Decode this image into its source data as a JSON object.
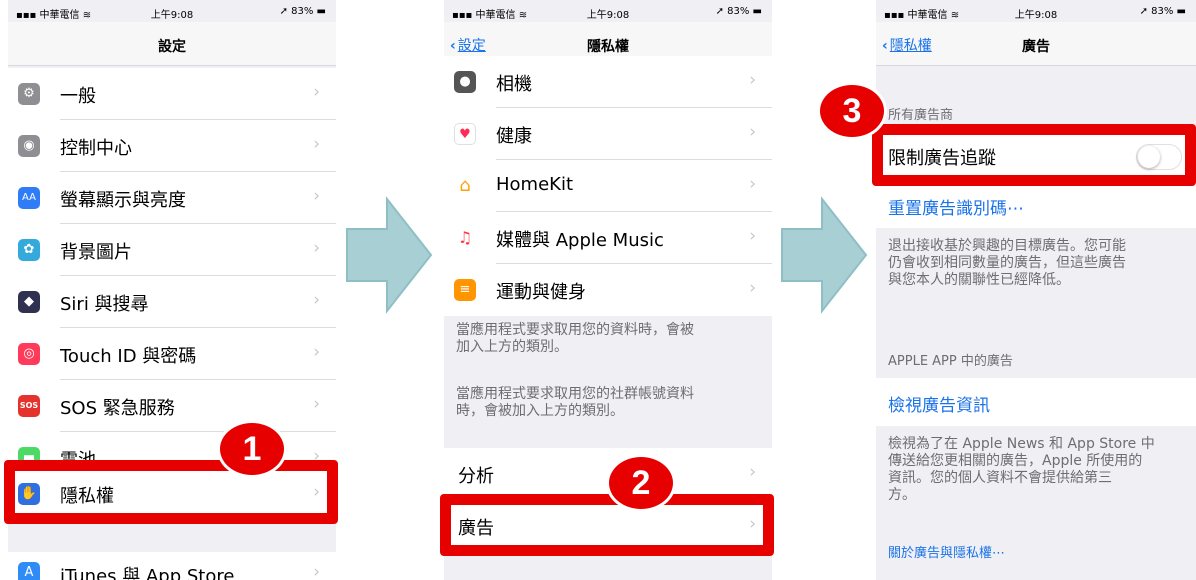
{
  "status": {
    "carrier": "▪▪▪ 中華電信 ≋",
    "time": "上午9:08",
    "battery": "➚ 83% ▬"
  },
  "phone1": {
    "title": "設定",
    "items": [
      {
        "label": "一般",
        "icon": "⚙",
        "icon_color": "#8e8e93"
      },
      {
        "label": "控制中心",
        "icon": "◉",
        "icon_color": "#8e8e93"
      },
      {
        "label": "螢幕顯示與亮度",
        "icon": "AA",
        "icon_color": "#2f7cf6"
      },
      {
        "label": "背景圖片",
        "icon": "✿",
        "icon_color": "#34aadc"
      },
      {
        "label": "Siri 與搜尋",
        "icon": "◆",
        "icon_color": "#303050"
      },
      {
        "label": "Touch ID 與密碼",
        "icon": "◎",
        "icon_color": "#ff3b5c"
      },
      {
        "label": "SOS 緊急服務",
        "icon": "SOS",
        "icon_color": "#e5322d"
      },
      {
        "label": "電池",
        "icon": "▬",
        "icon_color": "#4cd964"
      },
      {
        "label": "隱私權",
        "icon": "✋",
        "icon_color": "#2f6fe0"
      },
      {
        "label": "iTunes 與 App Store",
        "icon": "A",
        "icon_color": "#2f8cf6"
      }
    ]
  },
  "phone2": {
    "back": "設定",
    "title": "隱私權",
    "items": [
      {
        "label": "相機",
        "icon": "●",
        "icon_color": "#555555"
      },
      {
        "label": "健康",
        "icon": "♥",
        "icon_color": "#ffffff"
      },
      {
        "label": "HomeKit",
        "icon": "⌂",
        "icon_color": "#ff9f0a"
      },
      {
        "label": "媒體與 Apple Music",
        "icon": "♫",
        "icon_color": "#ffffff"
      },
      {
        "label": "運動與健身",
        "icon": "≡",
        "icon_color": "#ff9500"
      }
    ],
    "note1_line1": "當應用程式要求取用您的資料時，會被",
    "note1_line2": "加入上方的類別。",
    "note2_line1": "當應用程式要求取用您的社群帳號資料",
    "note2_line2": "時，會被加入上方的類別。",
    "analytics": "分析",
    "ads": "廣告"
  },
  "phone3": {
    "back": "隱私權",
    "title": "廣告",
    "section1": "所有廣告商",
    "limit_tracking": "限制廣告追蹤",
    "toggle_state": "off",
    "reset_link": "重置廣告識別碼⋯",
    "note1_line1": "退出接收基於興趣的目標廣告。您可能",
    "note1_line2": "仍會收到相同數量的廣告，但這些廣告",
    "note1_line3": "與您本人的關聯性已經降低。",
    "section2": "APPLE APP 中的廣告",
    "view_link": "檢視廣告資訊",
    "note2_line1": "檢視為了在 Apple News 和 App Store 中",
    "note2_line2": "傳送給您更相關的廣告，Apple 所使用的",
    "note2_line3": "資訊。您的個人資料不會提供給第三",
    "note2_line4": "方。",
    "about_link": "關於廣告與隱私權⋯"
  },
  "badges": {
    "b1": "1",
    "b2": "2",
    "b3": "3"
  },
  "colors": {
    "highlight": "#e60000",
    "arrow": "#a8d0d4",
    "link": "#1a73e8"
  }
}
